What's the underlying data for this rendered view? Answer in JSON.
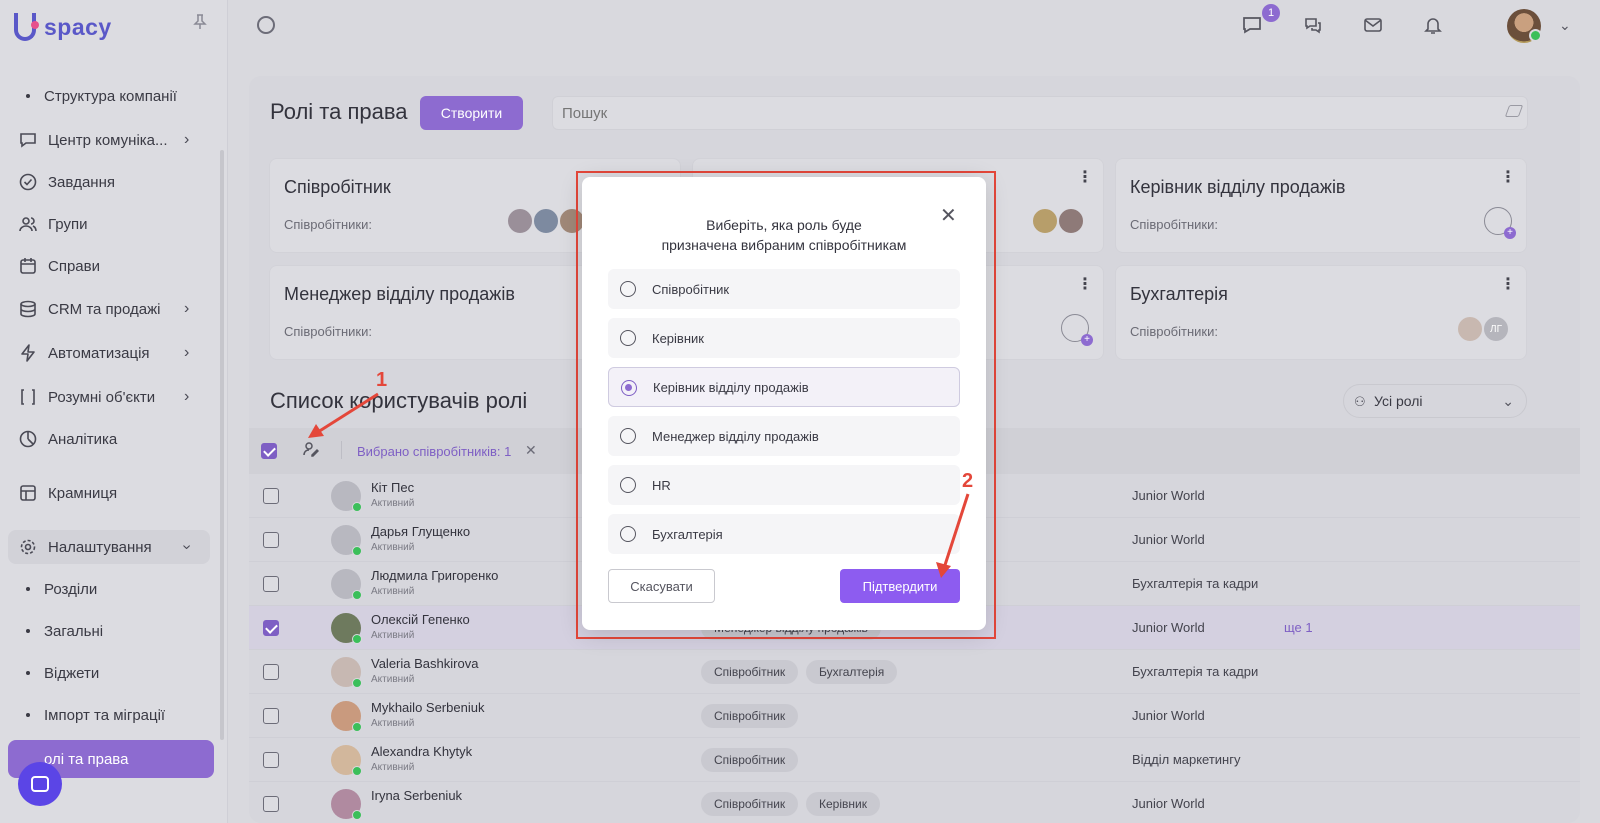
{
  "app": {
    "logo_text": "spacy"
  },
  "sidebar": {
    "items": [
      {
        "label": "Структура компанії",
        "type": "sub"
      },
      {
        "label": "Центр комунікацій",
        "display": "Центр комуніка...",
        "icon": "chat-icon",
        "has_submenu": true
      },
      {
        "label": "Завдання",
        "icon": "check-circle-icon"
      },
      {
        "label": "Групи",
        "icon": "users-icon"
      },
      {
        "label": "Справи",
        "icon": "calendar-icon"
      },
      {
        "label": "CRM та продажі",
        "icon": "database-icon",
        "has_submenu": true
      },
      {
        "label": "Автоматизація",
        "icon": "lightning-icon",
        "has_submenu": true
      },
      {
        "label": "Розумні об'єкти",
        "display": "Розумні об'єкти",
        "icon": "bracket-icon",
        "has_submenu": true
      },
      {
        "label": "Аналітика",
        "icon": "chart-icon"
      },
      {
        "label": "Крамниця",
        "icon": "store-icon"
      },
      {
        "label": "Налаштування",
        "icon": "gear-icon",
        "expanded": true
      }
    ],
    "settings_sub": [
      "Розділи",
      "Загальні",
      "Віджети",
      "Імпорт та міграції"
    ],
    "active_label": "Ролі та права",
    "active_display": "олі та права"
  },
  "topbar": {
    "chat_badge": "1"
  },
  "page": {
    "title": "Ролі та права",
    "create_label": "Створити",
    "search_placeholder": "Пошук"
  },
  "role_cards": [
    {
      "name": "Співробітник",
      "sub": "Співробітники:"
    },
    {
      "name": "",
      "sub": ""
    },
    {
      "name": "Керівник відділу продажів",
      "sub": "Співробітники:"
    },
    {
      "name": "Менеджер відділу продажів",
      "sub": "Співробітники:"
    },
    {
      "name": "",
      "sub": ""
    },
    {
      "name": "Бухгалтерія",
      "sub": "Співробітники:",
      "avatar_initials": "ЛГ"
    }
  ],
  "users_list": {
    "title": "Список користувачів ролі",
    "filter_label": "Усі ролі",
    "selected_text": "Вибрано співробітників: 1",
    "rows": [
      {
        "name": "Кіт Пес",
        "status": "Активний",
        "roles": [],
        "dept": "Junior World",
        "selected": false
      },
      {
        "name": "Дарья Глущенко",
        "status": "Активний",
        "roles": [],
        "dept": "Junior World",
        "selected": false
      },
      {
        "name": "Людмила Григоренко",
        "status": "Активний",
        "roles": [],
        "dept": "Бухгалтерія та кадри",
        "selected": false
      },
      {
        "name": "Олексій Гепенко",
        "status": "Активний",
        "roles": [
          "Менеджер відділу продажів"
        ],
        "dept": "Junior World",
        "more": "ще 1",
        "selected": true
      },
      {
        "name": "Valeria Bashkirova",
        "status": "Активний",
        "roles": [
          "Співробітник",
          "Бухгалтерія"
        ],
        "dept": "Бухгалтерія та кадри",
        "selected": false
      },
      {
        "name": "Mykhailo Serbeniuk",
        "status": "Активний",
        "roles": [
          "Співробітник"
        ],
        "dept": "Junior World",
        "selected": false
      },
      {
        "name": "Alexandra Khytyk",
        "status": "Активний",
        "roles": [
          "Співробітник"
        ],
        "dept": "Відділ маркетингу",
        "selected": false
      },
      {
        "name": "Iryna Serbeniuk",
        "status": "",
        "roles": [
          "Співробітник",
          "Керівник"
        ],
        "dept": "Junior World",
        "selected": false
      }
    ]
  },
  "modal": {
    "title_line1": "Виберіть, яка роль буде",
    "title_line2": "призначена вибраним співробітникам",
    "options": [
      "Співробітник",
      "Керівник",
      "Керівник відділу продажів",
      "Менеджер відділу продажів",
      "HR",
      "Бухгалтерія"
    ],
    "selected_option": "Керівник відділу продажів",
    "cancel_label": "Скасувати",
    "confirm_label": "Підтвердити"
  },
  "annotations": {
    "step1": "1",
    "step2": "2",
    "color": "#e4473a"
  },
  "colors": {
    "accent": "#8d6bd0",
    "confirm": "#8d5cf0",
    "online": "#3bbf5a"
  }
}
